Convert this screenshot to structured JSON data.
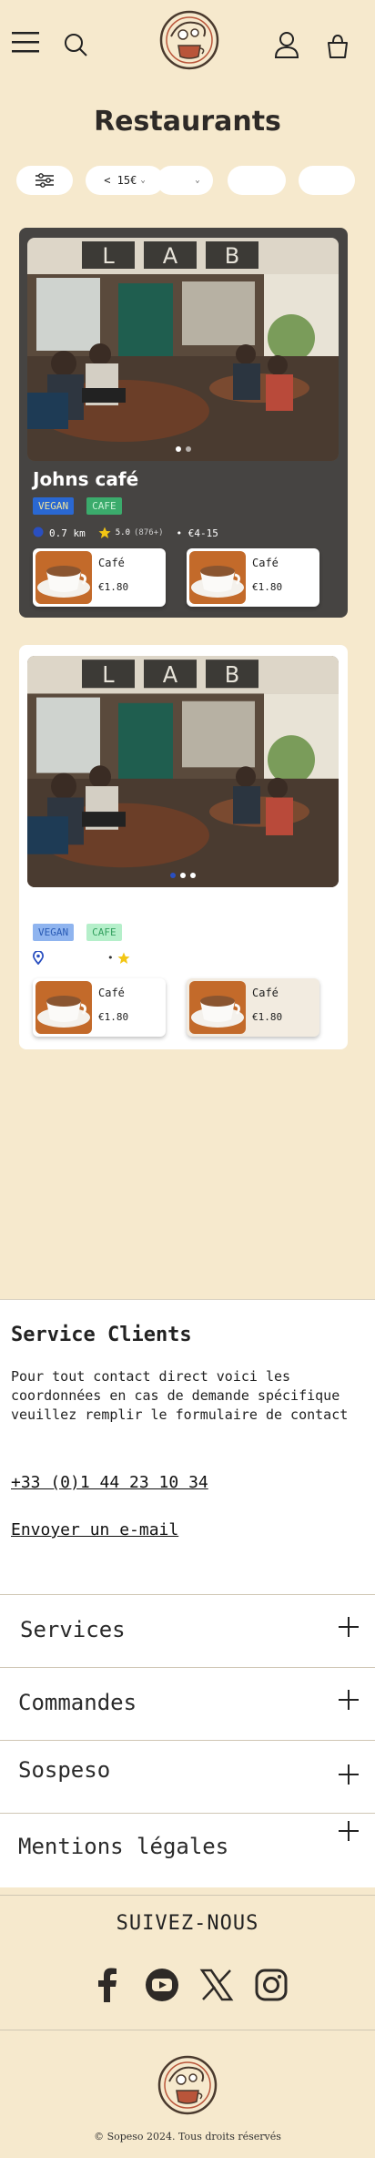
{
  "header": {
    "menu_icon": "hamburger-menu-icon",
    "search_icon": "search-icon",
    "logo": "sospeso-logo",
    "account_icon": "user-icon",
    "bag_icon": "shopping-bag-icon"
  },
  "page": {
    "title": "Restaurants"
  },
  "filters": {
    "filter_icon": "sliders-icon",
    "price": "< 15€",
    "options": [
      "",
      "",
      ""
    ]
  },
  "cards": [
    {
      "name": "Johns café",
      "tags": [
        "VEGAN",
        "CAFE"
      ],
      "distance": "0.7 km",
      "rating": "5.0",
      "reviews": "(876+)",
      "price_range": "• €4-15",
      "products": [
        {
          "name": "Café",
          "price": "€1.80"
        },
        {
          "name": "Café",
          "price": "€1.80"
        }
      ],
      "carousel": {
        "count": 2,
        "active": 1
      }
    },
    {
      "name": "",
      "tags": [
        "VEGAN",
        "CAFE"
      ],
      "distance": "",
      "rating": "",
      "reviews": "",
      "price_range": "•",
      "products": [
        {
          "name": "Café",
          "price": "€1.80"
        },
        {
          "name": "Café",
          "price": "€1.80"
        }
      ],
      "carousel": {
        "count": 3,
        "active": 0
      }
    }
  ],
  "customer_service": {
    "title": "Service Clients",
    "text": "Pour tout contact direct voici les coordonnées en cas de demande spécifique veuillez remplir le formulaire de contact",
    "phone": "+33 (0)1 44 23 10 34",
    "email_link": "Envoyer un e-mail"
  },
  "accordion": [
    "Services",
    "Commandes",
    "Sospeso",
    "Mentions légales"
  ],
  "social": {
    "title": "SUIVEZ-NOUS",
    "icons": [
      "facebook-icon",
      "youtube-icon",
      "x-icon",
      "instagram-icon"
    ]
  },
  "footer": {
    "copyright": "© Sopeso 2024. Tous droits réservés"
  },
  "colors": {
    "background": "#f6e9cd",
    "card_dark": "#464442",
    "vegan_tag": "#2a68d2",
    "cafe_tag": "#3bab6c",
    "star": "#f3c614",
    "pin": "#2a4fc0"
  }
}
